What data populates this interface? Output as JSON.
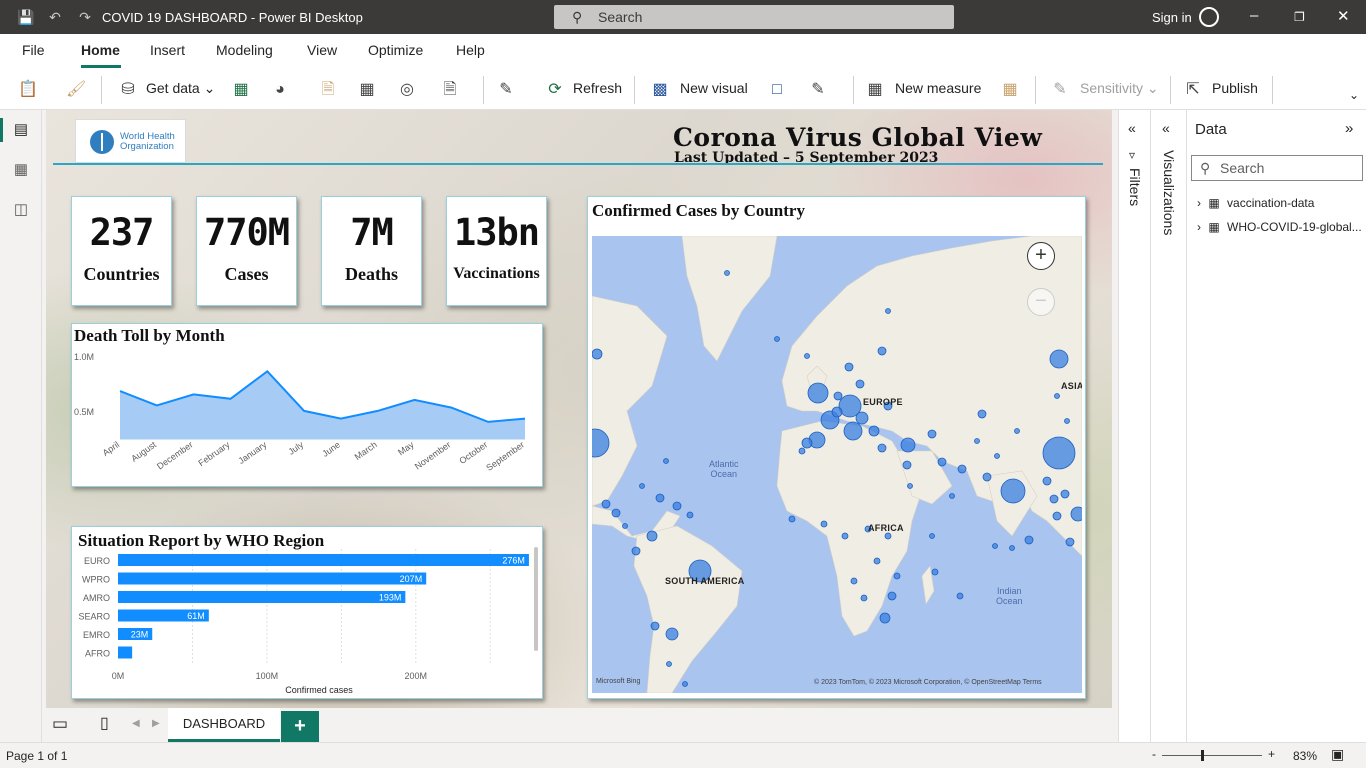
{
  "window": {
    "title": "COVID 19 DASHBOARD - Power BI Desktop",
    "search_placeholder": "Search",
    "sign_in": "Sign in"
  },
  "menu": {
    "file": "File",
    "home": "Home",
    "insert": "Insert",
    "modeling": "Modeling",
    "view": "View",
    "optimize": "Optimize",
    "help": "Help"
  },
  "ribbon": {
    "get_data": "Get data",
    "refresh": "Refresh",
    "new_visual": "New visual",
    "new_measure": "New measure",
    "sensitivity": "Sensitivity",
    "publish": "Publish"
  },
  "report": {
    "logo_text_line1": "World Health",
    "logo_text_line2": "Organization",
    "title": "Corona Virus Global View",
    "subtitle": "Last Updated – 5 September 2023",
    "kpis": [
      {
        "value": "237",
        "label": "Countries"
      },
      {
        "value": "770M",
        "label": "Cases"
      },
      {
        "value": "7M",
        "label": "Deaths"
      },
      {
        "value": "13bn",
        "label": "Vaccinations"
      }
    ],
    "map": {
      "title": "Confirmed Cases by Country",
      "labels": {
        "europe": "EUROPE",
        "asia": "ASIA",
        "africa": "AFRICA",
        "south_america": "SOUTH AMERICA"
      },
      "oceans": {
        "atlantic_1": "Atlantic",
        "atlantic_2": "Ocean",
        "indian_1": "Indian",
        "indian_2": "Ocean"
      },
      "attribution": "© 2023 TomTom, © 2023 Microsoft Corporation, © OpenStreetMap  Terms",
      "bing": "Microsoft Bing"
    }
  },
  "chart_data": [
    {
      "type": "area",
      "title": "Death Toll by Month",
      "categories": [
        "April",
        "August",
        "December",
        "February",
        "January",
        "July",
        "June",
        "March",
        "May",
        "November",
        "October",
        "September"
      ],
      "values": [
        690000,
        560000,
        660000,
        620000,
        870000,
        510000,
        440000,
        510000,
        610000,
        540000,
        410000,
        440000
      ],
      "y_ticks": [
        "1.0M",
        "0.5M"
      ],
      "ylim": [
        0,
        1000000
      ],
      "color": "#118dff"
    },
    {
      "type": "bar",
      "orientation": "horizontal",
      "title": "Situation Report by WHO Region",
      "categories": [
        "EURO",
        "WPRO",
        "AMRO",
        "SEARO",
        "EMRO",
        "AFRO"
      ],
      "values": [
        276,
        207,
        193,
        61,
        23,
        9.5
      ],
      "data_labels": [
        "276M",
        "207M",
        "193M",
        "61M",
        "23M",
        ""
      ],
      "x_ticks": [
        "0M",
        "100M",
        "200M"
      ],
      "xlim": [
        0,
        270
      ],
      "xlabel": "Confirmed cases",
      "color": "#118dff"
    }
  ],
  "data_pane": {
    "title": "Data",
    "search_placeholder": "Search",
    "tables": [
      "vaccination-data",
      "WHO-COVID-19-global..."
    ]
  },
  "side_panes": {
    "filters": "Filters",
    "visualizations": "Visualizations"
  },
  "tabs": {
    "active": "DASHBOARD"
  },
  "status": {
    "page": "Page 1 of 1",
    "zoom": "83%"
  }
}
